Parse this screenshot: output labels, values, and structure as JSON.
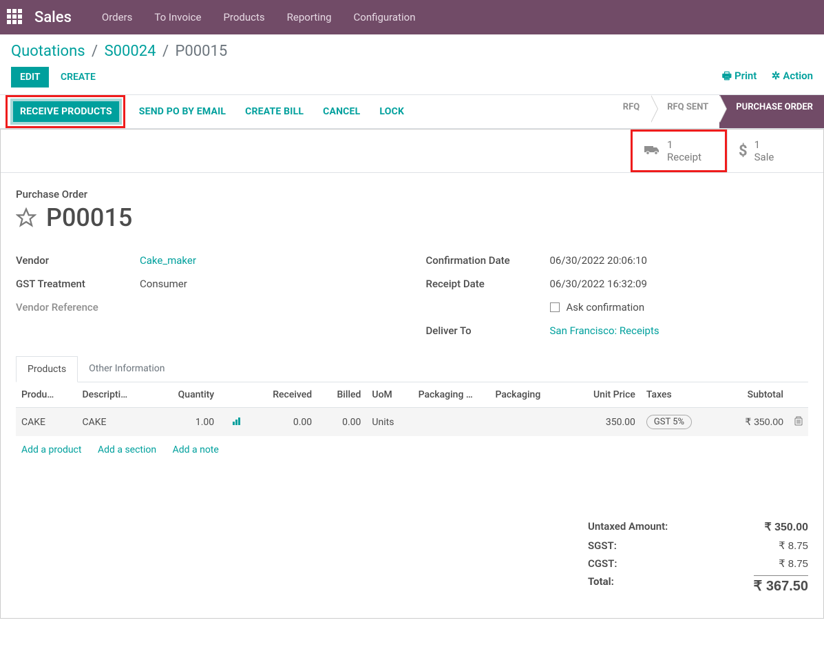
{
  "topnav": {
    "app": "Sales",
    "links": [
      "Orders",
      "To Invoice",
      "Products",
      "Reporting",
      "Configuration"
    ]
  },
  "breadcrumb": {
    "root": "Quotations",
    "parent": "S00024",
    "current": "P00015"
  },
  "buttons": {
    "edit": "EDIT",
    "create": "CREATE",
    "print": "Print",
    "action": "Action"
  },
  "statusbar": {
    "actions": [
      "RECEIVE PRODUCTS",
      "SEND PO BY EMAIL",
      "CREATE BILL",
      "CANCEL",
      "LOCK"
    ],
    "statuses": [
      "RFQ",
      "RFQ SENT",
      "PURCHASE ORDER"
    ],
    "active_status_index": 2
  },
  "stat_buttons": {
    "receipt": {
      "count": "1",
      "label": "Receipt"
    },
    "sale": {
      "count": "1",
      "label": "Sale"
    }
  },
  "header": {
    "label": "Purchase Order",
    "name": "P00015"
  },
  "fields_left": {
    "vendor_label": "Vendor",
    "vendor": "Cake_maker",
    "gst_label": "GST Treatment",
    "gst": "Consumer",
    "vendor_ref_label": "Vendor Reference",
    "vendor_ref": ""
  },
  "fields_right": {
    "conf_date_label": "Confirmation Date",
    "conf_date": "06/30/2022 20:06:10",
    "receipt_date_label": "Receipt Date",
    "receipt_date": "06/30/2022 16:32:09",
    "ask_conf_label": "Ask confirmation",
    "deliver_to_label": "Deliver To",
    "deliver_to": "San Francisco: Receipts"
  },
  "tabs": [
    "Products",
    "Other Information"
  ],
  "table": {
    "headers": [
      "Produ…",
      "Descripti…",
      "Quantity",
      "Received",
      "Billed",
      "UoM",
      "Packaging …",
      "Packaging",
      "Unit Price",
      "Taxes",
      "Subtotal"
    ],
    "row": {
      "product": "CAKE",
      "desc": "CAKE",
      "qty": "1.00",
      "received": "0.00",
      "billed": "0.00",
      "uom": "Units",
      "pkg_qty": "",
      "pkg": "",
      "unit_price": "350.00",
      "taxes": "GST 5%",
      "subtotal": "₹ 350.00"
    },
    "add_product": "Add a product",
    "add_section": "Add a section",
    "add_note": "Add a note"
  },
  "totals": {
    "untaxed_lbl": "Untaxed Amount:",
    "untaxed": "₹ 350.00",
    "sgst_lbl": "SGST:",
    "sgst": "₹ 8.75",
    "cgst_lbl": "CGST:",
    "cgst": "₹ 8.75",
    "total_lbl": "Total:",
    "total": "₹ 367.50"
  }
}
